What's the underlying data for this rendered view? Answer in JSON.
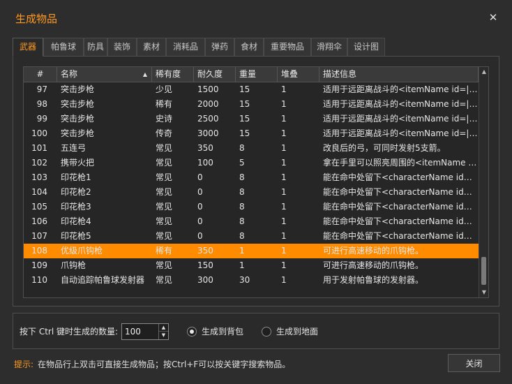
{
  "window": {
    "title": "生成物品",
    "close_glyph": "✕"
  },
  "tabs": [
    {
      "label": "武器",
      "active": true
    },
    {
      "label": "帕鲁球"
    },
    {
      "label": "防具"
    },
    {
      "label": "装饰"
    },
    {
      "label": "素材"
    },
    {
      "label": "消耗品"
    },
    {
      "label": "弹药"
    },
    {
      "label": "食材"
    },
    {
      "label": "重要物品"
    },
    {
      "label": "滑翔伞"
    },
    {
      "label": "设计图"
    }
  ],
  "table": {
    "columns": [
      "#",
      "名称",
      "稀有度",
      "耐久度",
      "重量",
      "堆叠",
      "描述信息"
    ],
    "sort_column": "名称",
    "sort_direction": "ascending",
    "rows": [
      [
        "97",
        "突击步枪",
        "少见",
        "1500",
        "15",
        "1",
        "适用于远距离战斗的<itemName id=|A..."
      ],
      [
        "98",
        "突击步枪",
        "稀有",
        "2000",
        "15",
        "1",
        "适用于远距离战斗的<itemName id=|A..."
      ],
      [
        "99",
        "突击步枪",
        "史诗",
        "2500",
        "15",
        "1",
        "适用于远距离战斗的<itemName id=|A..."
      ],
      [
        "100",
        "突击步枪",
        "传奇",
        "3000",
        "15",
        "1",
        "适用于远距离战斗的<itemName id=|A..."
      ],
      [
        "101",
        "五连弓",
        "常见",
        "350",
        "8",
        "1",
        "改良后的弓，可同时发射5支箭。"
      ],
      [
        "102",
        "携带火把",
        "常见",
        "100",
        "5",
        "1",
        "拿在手里可以照亮周围的<itemName i..."
      ],
      [
        "103",
        "印花枪1",
        "常见",
        "0",
        "8",
        "1",
        "能在命中处留下<characterName id=|..."
      ],
      [
        "104",
        "印花枪2",
        "常见",
        "0",
        "8",
        "1",
        "能在命中处留下<characterName id=|..."
      ],
      [
        "105",
        "印花枪3",
        "常见",
        "0",
        "8",
        "1",
        "能在命中处留下<characterName id=|..."
      ],
      [
        "106",
        "印花枪4",
        "常见",
        "0",
        "8",
        "1",
        "能在命中处留下<characterName id=|..."
      ],
      [
        "107",
        "印花枪5",
        "常见",
        "0",
        "8",
        "1",
        "能在命中处留下<characterName id=|..."
      ],
      [
        "108",
        "优级爪钩枪",
        "稀有",
        "350",
        "1",
        "1",
        "可进行高速移动的爪钩枪。"
      ],
      [
        "109",
        "爪钩枪",
        "常见",
        "150",
        "1",
        "1",
        "可进行高速移动的爪钩枪。"
      ],
      [
        "110",
        "自动追踪帕鲁球发射器",
        "常见",
        "300",
        "30",
        "1",
        "用于发射帕鲁球的发射器。"
      ]
    ],
    "selected_row_id": "108"
  },
  "options": {
    "quantity_label": "按下 Ctrl 键时生成的数量:",
    "quantity_value": "100",
    "radio_backpack": "生成到背包",
    "radio_ground": "生成到地面",
    "selected_target": "backpack"
  },
  "footer": {
    "hint_key": "提示:",
    "hint_text": "在物品行上双击可直接生成物品；按Ctrl+F可以按关键字搜索物品。",
    "close_label": "关闭"
  },
  "colors": {
    "accent": "#ff9a1f",
    "selection": "#ff8c00",
    "background": "#2d2d2d"
  },
  "icons": {
    "sort": "sort-up-icon",
    "scroll_up": "scroll-up-arrow-icon",
    "scroll_down": "scroll-down-arrow-icon"
  }
}
